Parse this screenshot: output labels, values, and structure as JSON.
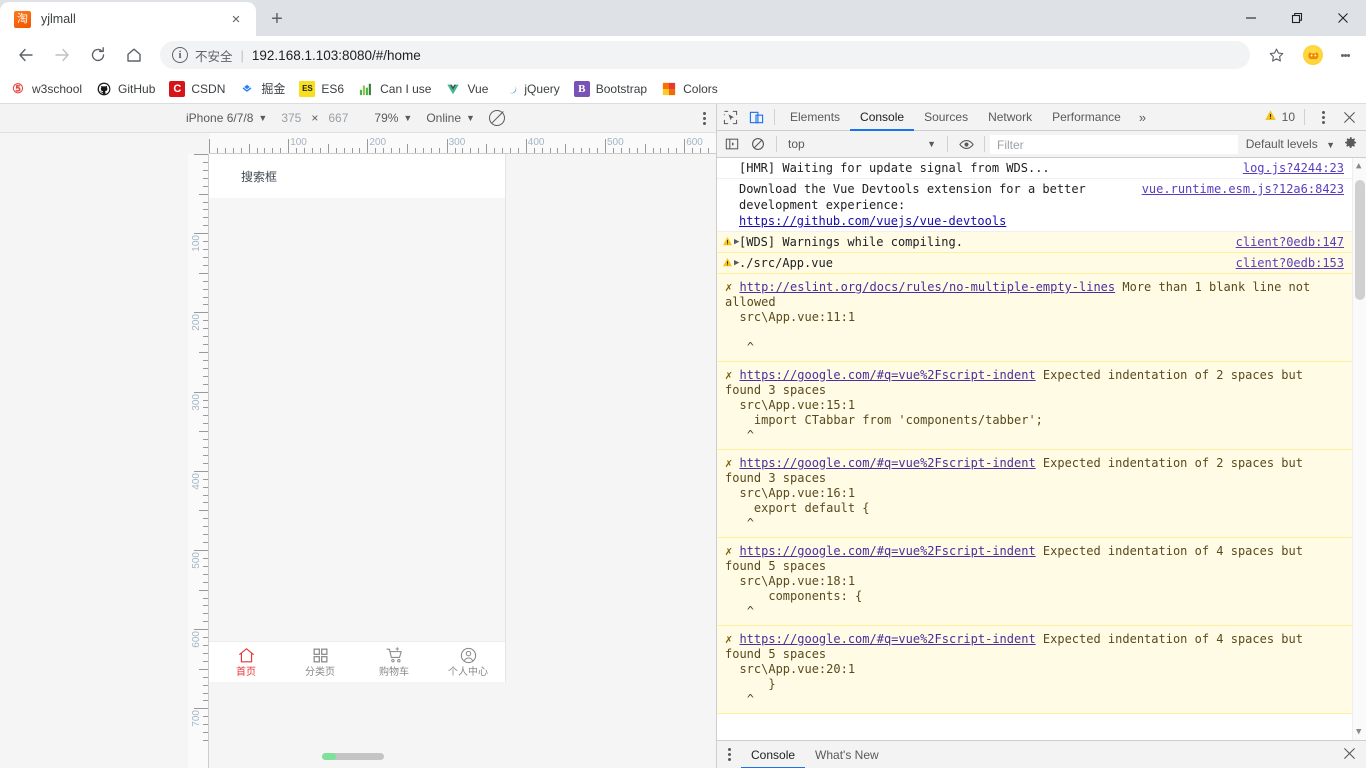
{
  "window": {
    "minimize": "minimize",
    "maximize": "restore",
    "close": "close"
  },
  "tab": {
    "title": "yjlmall",
    "favicon_char": "淘",
    "close_label": "×",
    "new_tab_label": "+"
  },
  "omnibox": {
    "info_char": "i",
    "insecure_label": "不安全",
    "separator": "|",
    "url_host": "192.168.1.103:8080",
    "url_path": "/#/home",
    "url_full": "192.168.1.103:8080/#/home"
  },
  "bookmarks": [
    {
      "label": "w3school",
      "icon_char": "S",
      "icon_bg": "#ffffff",
      "icon_color": "#e8453c"
    },
    {
      "label": "GitHub",
      "icon_char": "",
      "icon_bg": "#ffffff",
      "icon_color": "#181717"
    },
    {
      "label": "CSDN",
      "icon_char": "C",
      "icon_bg": "#d6151a",
      "icon_color": "#ffffff"
    },
    {
      "label": "掘金",
      "icon_char": "≈",
      "icon_bg": "#ffffff",
      "icon_color": "#1e80ff"
    },
    {
      "label": "ES6",
      "icon_char": "ES",
      "icon_bg": "#f7df1e",
      "icon_color": "#333333"
    },
    {
      "label": "Can I use",
      "icon_char": "⣿",
      "icon_bg": "#ffffff",
      "icon_color": "#4caf50"
    },
    {
      "label": "Vue",
      "icon_char": "V",
      "icon_bg": "#ffffff",
      "icon_color": "#41b883"
    },
    {
      "label": "jQuery",
      "icon_char": "◖",
      "icon_bg": "#ffffff",
      "icon_color": "#0769ad"
    },
    {
      "label": "Bootstrap",
      "icon_char": "B",
      "icon_bg": "#7952b3",
      "icon_color": "#ffffff"
    },
    {
      "label": "Colors",
      "icon_char": "▦",
      "icon_bg": "#ffffff",
      "icon_color": "#ff6f00"
    }
  ],
  "device_toolbar": {
    "device_name": "iPhone 6/7/8",
    "width": "375",
    "times": "×",
    "height": "667",
    "zoom": "79%",
    "network": "Online",
    "throttle_icon": "no-throttling-icon",
    "more_options": "⋮"
  },
  "rulers": {
    "horizontal": [
      "100",
      "200",
      "300",
      "400",
      "500",
      "600"
    ],
    "vertical": [
      "100",
      "200",
      "300",
      "400",
      "500",
      "600",
      "700"
    ]
  },
  "phone": {
    "search_placeholder": "搜索框",
    "tabbar": [
      {
        "label": "首页",
        "icon": "home-icon",
        "active": true
      },
      {
        "label": "分类页",
        "icon": "grid-icon",
        "active": false
      },
      {
        "label": "购物车",
        "icon": "cart-icon",
        "active": false
      },
      {
        "label": "个人中心",
        "icon": "user-icon",
        "active": false
      }
    ]
  },
  "devtools": {
    "inspect_icon": "inspect-element-icon",
    "device_toggle_icon": "device-toolbar-icon",
    "tabs": [
      "Elements",
      "Console",
      "Sources",
      "Network",
      "Performance"
    ],
    "active_tab": "Console",
    "more_tabs": "»",
    "warning_count": "10",
    "settings_kebab": "⋮",
    "close": "✕",
    "filterbar": {
      "sidebar_icon": "console-sidebar-icon",
      "clear_icon": "clear-console-icon",
      "context": "top",
      "eye_icon": "live-expression-icon",
      "filter_placeholder": "Filter",
      "levels": "Default levels",
      "settings_icon": "settings-gear-icon"
    },
    "drawer": {
      "kebab": "⋮",
      "tabs": [
        "Console",
        "What's New"
      ],
      "active_tab": "Console",
      "close": "✕"
    }
  },
  "console_messages": [
    {
      "type": "log",
      "text": "[HMR] Waiting for update signal from WDS...",
      "source": "log.js?4244:23"
    },
    {
      "type": "log",
      "text": "Download the Vue Devtools extension for a better development experience:",
      "link": "https://github.com/vuejs/vue-devtools",
      "source": "vue.runtime.esm.js?12a6:8423"
    },
    {
      "type": "warning",
      "text": "[WDS] Warnings while compiling.",
      "source": "client?0edb:147"
    },
    {
      "type": "warning",
      "text": "./src/App.vue",
      "source": "client?0edb:153"
    }
  ],
  "eslint_errors": [
    {
      "mark": "✗",
      "rule_url": "http://eslint.org/docs/rules/no-multiple-empty-lines",
      "message": "More than 1 blank line not allowed",
      "location": "src\\App.vue:11:1",
      "code": "",
      "caret": "^"
    },
    {
      "mark": "✗",
      "rule_url": "https://google.com/#q=vue%2Fscript-indent",
      "message": "Expected indentation of 2 spaces but found 3 spaces",
      "location": "src\\App.vue:15:1",
      "code": "  import CTabbar from 'components/tabber';",
      "caret": "^"
    },
    {
      "mark": "✗",
      "rule_url": "https://google.com/#q=vue%2Fscript-indent",
      "message": "Expected indentation of 2 spaces but found 3 spaces",
      "location": "src\\App.vue:16:1",
      "code": "  export default {",
      "caret": "^"
    },
    {
      "mark": "✗",
      "rule_url": "https://google.com/#q=vue%2Fscript-indent",
      "message": "Expected indentation of 4 spaces but found 5 spaces",
      "location": "src\\App.vue:18:1",
      "code": "    components: {",
      "caret": "^"
    },
    {
      "mark": "✗",
      "rule_url": "https://google.com/#q=vue%2Fscript-indent",
      "message": "Expected indentation of 4 spaces but found 5 spaces",
      "location": "src\\App.vue:20:1",
      "code": "    }",
      "caret": "^"
    }
  ],
  "colors": {
    "accent": "#1a73e8",
    "warning_bg": "#fffbe5",
    "tab_active": "#e4393c",
    "link": "#1a0dab"
  }
}
